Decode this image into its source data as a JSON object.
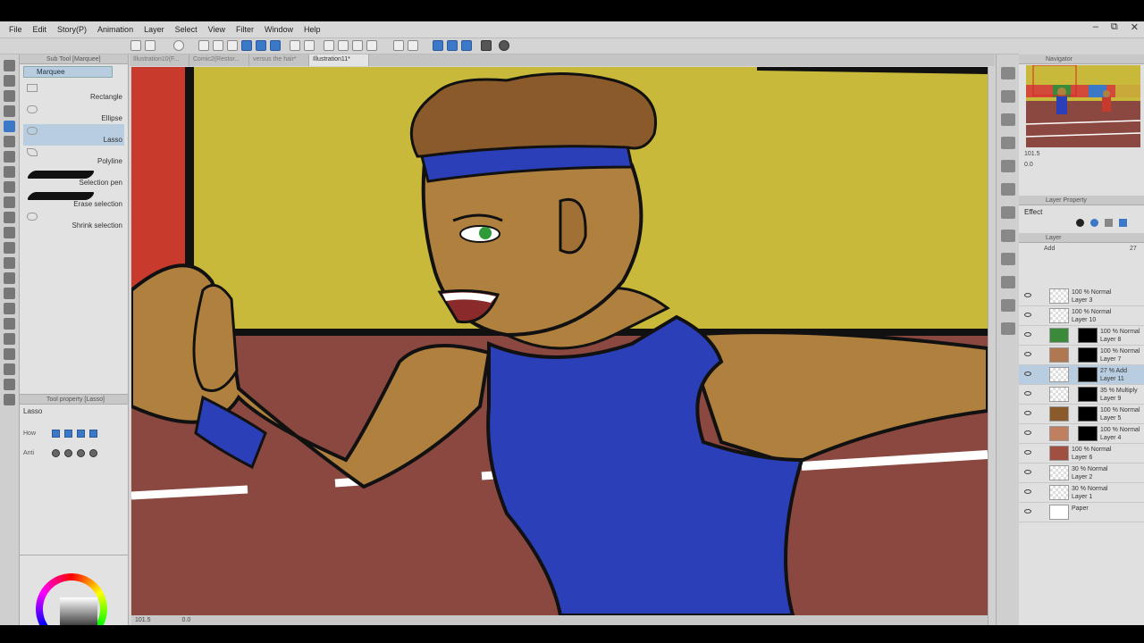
{
  "menu": [
    "File",
    "Edit",
    "Story(P)",
    "Animation",
    "Layer",
    "Select",
    "View",
    "Filter",
    "Window",
    "Help"
  ],
  "doc_tabs": [
    "Illustration10(F...",
    "Comic2(Restor...",
    "versus the hair*",
    "Illustration11*"
  ],
  "subtool": {
    "header": "Sub Tool [Marquee]",
    "active_tab": "Marquee",
    "items": [
      "Rectangle",
      "Ellipse",
      "Lasso",
      "Polyline",
      "Selection pen",
      "Erase selection",
      "Shrink selection"
    ]
  },
  "tool_property": {
    "header": "Tool property [Lasso]",
    "tool_name": "Lasso",
    "how_label": "How",
    "anti_label": "Anti"
  },
  "canvas_status": {
    "zoom": "101.5",
    "angle": "0.0"
  },
  "navigator": {
    "header": "Navigator",
    "zoom": "101.5",
    "angle": "0.0"
  },
  "layer_property": {
    "header": "Layer Property",
    "effect_label": "Effect"
  },
  "layer_panel": {
    "header": "Layer",
    "blend_mode": "Add",
    "opacity": "27"
  },
  "layers": [
    {
      "mode": "100 % Normal",
      "name": "Layer 3",
      "has_mask": false,
      "thumb": "transparent"
    },
    {
      "mode": "100 % Normal",
      "name": "Layer 10",
      "has_mask": false,
      "thumb": "transparent"
    },
    {
      "mode": "100 % Normal",
      "name": "Layer 8",
      "has_mask": true,
      "thumb": "#3a8a3a"
    },
    {
      "mode": "100 % Normal",
      "name": "Layer 7",
      "has_mask": true,
      "thumb": "#b07850"
    },
    {
      "mode": "27 % Add",
      "name": "Layer 11",
      "has_mask": true,
      "thumb": "transparent",
      "selected": true
    },
    {
      "mode": "35 % Multiply",
      "name": "Layer 9",
      "has_mask": true,
      "thumb": "transparent"
    },
    {
      "mode": "100 % Normal",
      "name": "Layer 5",
      "has_mask": true,
      "thumb": "#8a5a2a"
    },
    {
      "mode": "100 % Normal",
      "name": "Layer 4",
      "has_mask": true,
      "thumb": "#c08060"
    },
    {
      "mode": "100 % Normal",
      "name": "Layer 6",
      "has_mask": false,
      "thumb": "#a05040"
    },
    {
      "mode": "30 % Normal",
      "name": "Layer 2",
      "has_mask": false,
      "thumb": "transparent"
    },
    {
      "mode": "30 % Normal",
      "name": "Layer 1",
      "has_mask": false,
      "thumb": "transparent"
    },
    {
      "mode": "",
      "name": "Paper",
      "has_mask": false,
      "thumb": "#ffffff"
    }
  ],
  "colors": {
    "accent": "#3b78c8",
    "selection": "#b8cde0",
    "canvas_track": "#8a4840",
    "wall_yellow": "#c9b93a",
    "shirt_blue": "#2a3fb8",
    "skin": "#b0803f",
    "hair": "#8a5a2a"
  }
}
